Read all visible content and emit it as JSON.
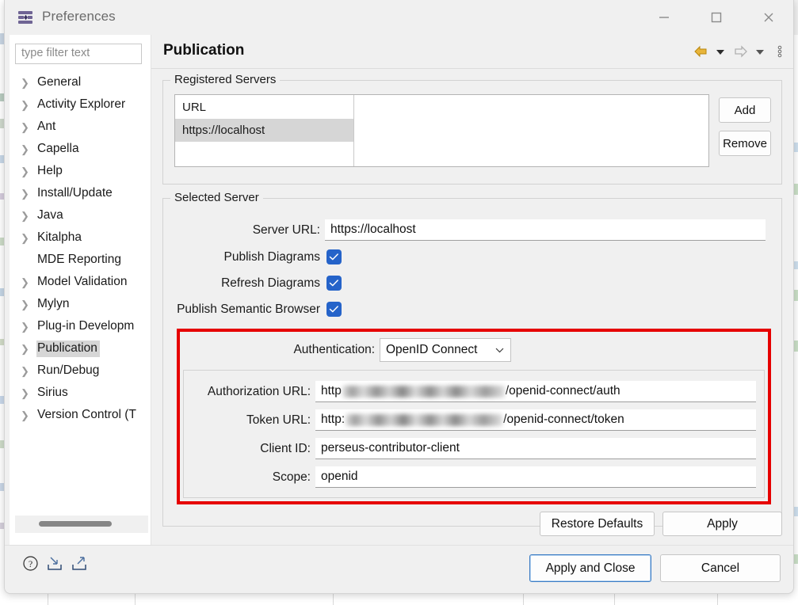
{
  "window": {
    "title": "Preferences",
    "icon": "preferences-sliders-icon",
    "minimize_label": "Minimize",
    "maximize_label": "Maximize",
    "close_label": "Close"
  },
  "sidebar": {
    "filter_placeholder": "type filter text",
    "filter_value": "",
    "items": [
      {
        "label": "General",
        "expandable": true,
        "selected": false
      },
      {
        "label": "Activity Explorer",
        "expandable": true,
        "selected": false
      },
      {
        "label": "Ant",
        "expandable": true,
        "selected": false
      },
      {
        "label": "Capella",
        "expandable": true,
        "selected": false
      },
      {
        "label": "Help",
        "expandable": true,
        "selected": false
      },
      {
        "label": "Install/Update",
        "expandable": true,
        "selected": false
      },
      {
        "label": "Java",
        "expandable": true,
        "selected": false
      },
      {
        "label": "Kitalpha",
        "expandable": true,
        "selected": false
      },
      {
        "label": "MDE Reporting",
        "expandable": false,
        "selected": false
      },
      {
        "label": "Model Validation",
        "expandable": true,
        "selected": false
      },
      {
        "label": "Mylyn",
        "expandable": true,
        "selected": false
      },
      {
        "label": "Plug-in Developm",
        "expandable": true,
        "selected": false
      },
      {
        "label": "Publication",
        "expandable": true,
        "selected": true
      },
      {
        "label": "Run/Debug",
        "expandable": true,
        "selected": false
      },
      {
        "label": "Sirius",
        "expandable": true,
        "selected": false
      },
      {
        "label": "Version Control (T",
        "expandable": true,
        "selected": false
      }
    ]
  },
  "page": {
    "title": "Publication",
    "nav": {
      "back_label": "Back",
      "back_menu_label": "Back history",
      "forward_label": "Forward",
      "forward_menu_label": "Forward history",
      "overflow_label": "View menu"
    }
  },
  "registered_servers": {
    "legend": "Registered Servers",
    "columns": [
      "URL"
    ],
    "rows": [
      {
        "url": "https://localhost",
        "selected": true
      }
    ],
    "add_label": "Add",
    "remove_label": "Remove"
  },
  "selected_server": {
    "legend": "Selected Server",
    "server_url_label": "Server URL:",
    "server_url_value": "https://localhost",
    "publish_diagrams_label": "Publish Diagrams",
    "publish_diagrams_checked": true,
    "refresh_diagrams_label": "Refresh Diagrams",
    "refresh_diagrams_checked": true,
    "publish_semantic_browser_label": "Publish Semantic Browser",
    "publish_semantic_browser_checked": true,
    "authentication_label": "Authentication:",
    "authentication_value": "OpenID Connect",
    "authorization_url_label": "Authorization URL:",
    "authorization_url_prefix": "http",
    "authorization_url_suffix": "/openid-connect/auth",
    "token_url_label": "Token URL:",
    "token_url_prefix": "http:",
    "token_url_suffix": "/openid-connect/token",
    "client_id_label": "Client ID:",
    "client_id_value": "perseus-contributor-client",
    "scope_label": "Scope:",
    "scope_value": "openid"
  },
  "page_actions": {
    "restore_defaults_label": "Restore Defaults",
    "apply_label": "Apply"
  },
  "footer": {
    "help_icon": "help-question-icon",
    "import_icon": "import-icon",
    "export_icon": "export-icon",
    "apply_and_close_label": "Apply and Close",
    "cancel_label": "Cancel"
  },
  "colors": {
    "accent_checkbox": "#2563c9",
    "highlight_rect": "#e60000",
    "selection": "#d6d6d6",
    "focus_border": "#3b7cc4",
    "back_arrow": "#e0a81f",
    "title_icon": "#6f6494"
  }
}
